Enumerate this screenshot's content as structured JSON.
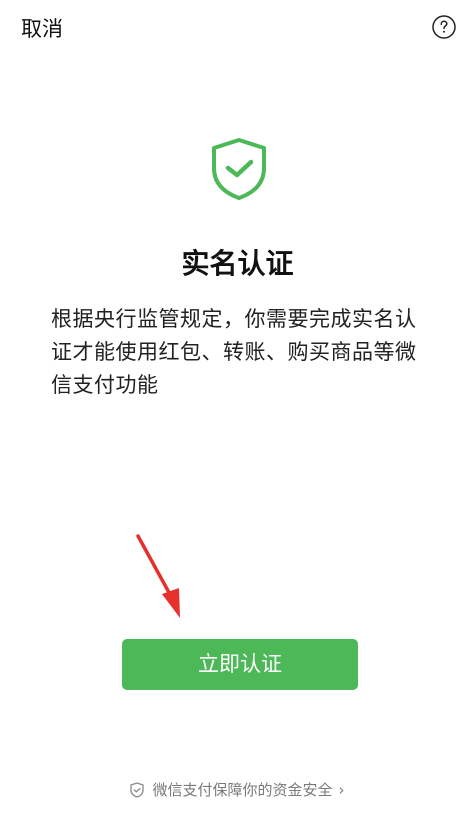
{
  "header": {
    "cancel_label": "取消",
    "help_icon": "question-mark-circle-icon"
  },
  "main": {
    "icon": "shield-check-icon",
    "title": "实名认证",
    "description": "根据央行监管规定，你需要完成实名认证才能使用红包、转账、购买商品等微信支付功能",
    "primary_button": "立即认证"
  },
  "footer": {
    "icon": "shield-check-icon",
    "text": "微信支付保障你的资金安全",
    "chevron": "›"
  },
  "colors": {
    "accent": "#4cb858",
    "annotation_arrow": "#e5302c"
  }
}
